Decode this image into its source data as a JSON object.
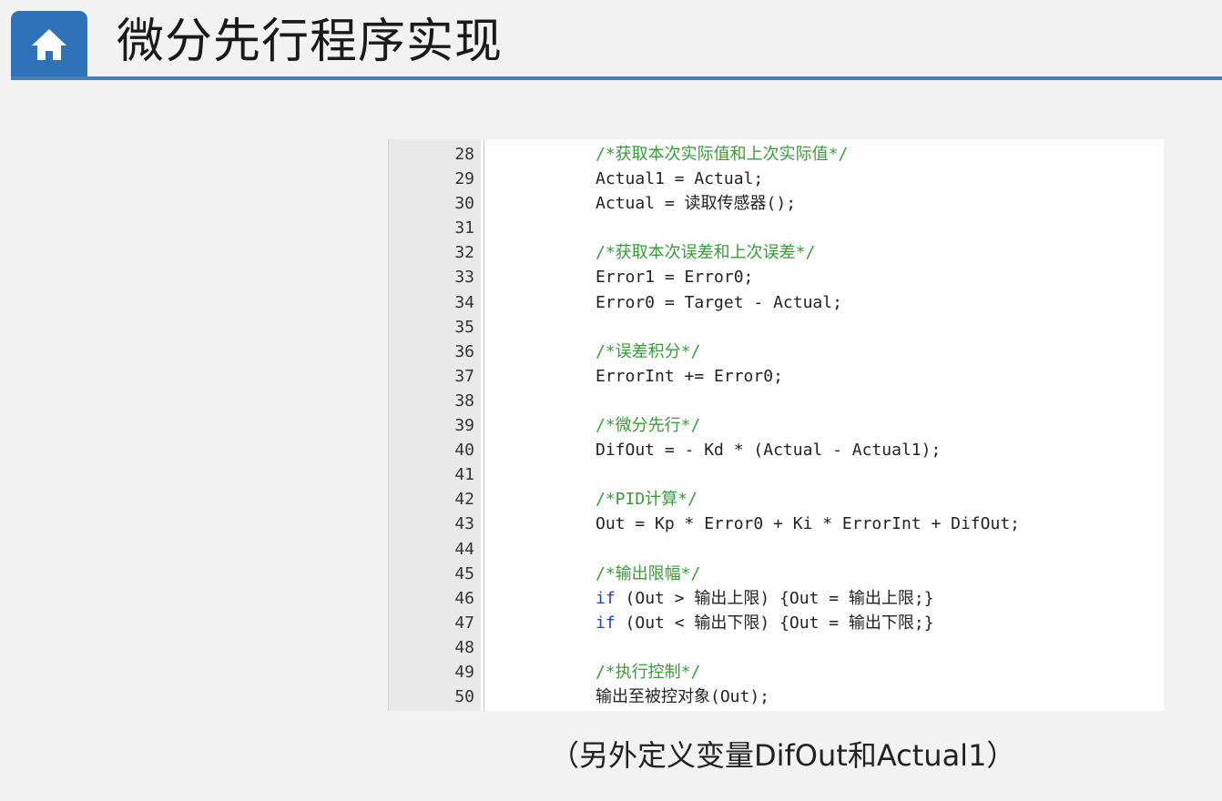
{
  "header": {
    "title": "微分先行程序实现",
    "home_icon": "home-icon",
    "accent_color": "#2e73b8"
  },
  "code": {
    "lines": [
      {
        "n": "28",
        "text": "/*获取本次实际值和上次实际值*/",
        "kind": "comment"
      },
      {
        "n": "29",
        "text": "Actual1 = Actual;",
        "kind": "code"
      },
      {
        "n": "30",
        "text": "Actual = 读取传感器();",
        "kind": "code"
      },
      {
        "n": "31",
        "text": "",
        "kind": "code"
      },
      {
        "n": "32",
        "text": "/*获取本次误差和上次误差*/",
        "kind": "comment"
      },
      {
        "n": "33",
        "text": "Error1 = Error0;",
        "kind": "code"
      },
      {
        "n": "34",
        "text": "Error0 = Target - Actual;",
        "kind": "code"
      },
      {
        "n": "35",
        "text": "",
        "kind": "code"
      },
      {
        "n": "36",
        "text": "/*误差积分*/",
        "kind": "comment"
      },
      {
        "n": "37",
        "text": "ErrorInt += Error0;",
        "kind": "code"
      },
      {
        "n": "38",
        "text": "",
        "kind": "code"
      },
      {
        "n": "39",
        "text": "/*微分先行*/",
        "kind": "comment"
      },
      {
        "n": "40",
        "text": "DifOut = - Kd * (Actual - Actual1);",
        "kind": "code"
      },
      {
        "n": "41",
        "text": "",
        "kind": "code"
      },
      {
        "n": "42",
        "text": "/*PID计算*/",
        "kind": "comment"
      },
      {
        "n": "43",
        "text": "Out = Kp * Error0 + Ki * ErrorInt + DifOut;",
        "kind": "code"
      },
      {
        "n": "44",
        "text": "",
        "kind": "code"
      },
      {
        "n": "45",
        "text": "/*输出限幅*/",
        "kind": "comment"
      },
      {
        "n": "46",
        "keyword": "if",
        "text": " (Out > 输出上限) {Out = 输出上限;}",
        "kind": "code"
      },
      {
        "n": "47",
        "keyword": "if",
        "text": " (Out < 输出下限) {Out = 输出下限;}",
        "kind": "code"
      },
      {
        "n": "48",
        "text": "",
        "kind": "code"
      },
      {
        "n": "49",
        "text": "/*执行控制*/",
        "kind": "comment"
      },
      {
        "n": "50",
        "text": "输出至被控对象(Out);",
        "kind": "code"
      }
    ]
  },
  "caption": "（另外定义变量DifOut和Actual1）"
}
